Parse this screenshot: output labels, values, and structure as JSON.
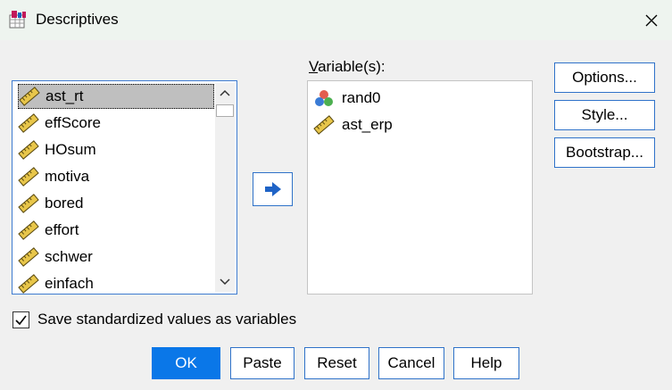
{
  "title": "Descriptives",
  "source_list": {
    "items": [
      {
        "label": "ast_rt",
        "icon": "ruler-icon",
        "selected": true
      },
      {
        "label": "effScore",
        "icon": "ruler-icon"
      },
      {
        "label": "HOsum",
        "icon": "ruler-icon"
      },
      {
        "label": "motiva",
        "icon": "ruler-icon"
      },
      {
        "label": "bored",
        "icon": "ruler-icon"
      },
      {
        "label": "effort",
        "icon": "ruler-icon"
      },
      {
        "label": "schwer",
        "icon": "ruler-icon"
      },
      {
        "label": "einfach",
        "icon": "ruler-icon"
      }
    ]
  },
  "variables": {
    "label": "Variable(s):",
    "items": [
      {
        "label": "rand0",
        "icon": "nominal-icon"
      },
      {
        "label": "ast_erp",
        "icon": "ruler-icon"
      }
    ]
  },
  "side_buttons": {
    "options": "Options...",
    "style": "Style...",
    "bootstrap": "Bootstrap..."
  },
  "checkbox": {
    "label": "Save standardized values as variables",
    "checked": true
  },
  "buttons": {
    "ok": "OK",
    "paste": "Paste",
    "reset": "Reset",
    "cancel": "Cancel",
    "help": "Help"
  },
  "colors": {
    "accent": "#0a77e8",
    "border_focus": "#2f72c9",
    "selection": "#bfbfbf",
    "titlebar": "#eef4ef"
  }
}
